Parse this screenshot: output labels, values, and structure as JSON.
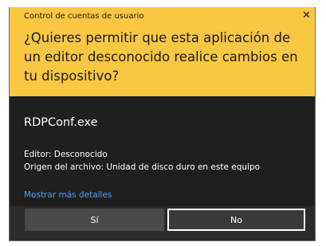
{
  "window": {
    "title": "Control de cuentas de usuario",
    "close_icon": "close-icon"
  },
  "header": {
    "question": "¿Quieres permitir que esta aplicación de un editor desconocido realice cambios en tu dispositivo?"
  },
  "app": {
    "name": "RDPConf.exe",
    "publisher": "Editor: Desconocido",
    "origin": "Origen del archivo: Unidad de disco duro en este equipo"
  },
  "links": {
    "details": "Mostrar más detalles"
  },
  "buttons": {
    "yes": "Sí",
    "no": "No"
  },
  "colors": {
    "header_bg": "#f9c742",
    "body_bg": "#1f1f1f",
    "link": "#4aa0f0"
  }
}
